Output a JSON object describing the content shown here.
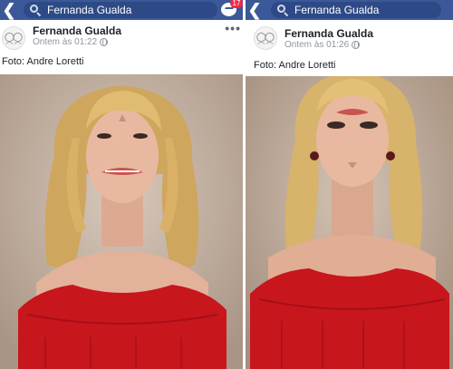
{
  "panels": [
    {
      "search_query": "Fernanda Gualda",
      "messenger_badge": "17",
      "author": "Fernanda Gualda",
      "timestamp": "Ontem às 01:22",
      "caption": "Foto: Andre Loretti",
      "more_label": "•••"
    },
    {
      "search_query": "Fernanda Gualda",
      "author": "Fernanda Gualda",
      "timestamp": "Ontem às 01:26",
      "caption": "Foto: Andre Loretti"
    }
  ],
  "colors": {
    "topbar": "#3b5998",
    "badge": "#f02849",
    "dress": "#c8161d",
    "hair": "#d8b268",
    "skin": "#e8b9a0",
    "backdrop": "#cbb8a8"
  },
  "icons": [
    "back-icon",
    "search-icon",
    "messenger-icon",
    "globe-icon",
    "more-icon"
  ]
}
